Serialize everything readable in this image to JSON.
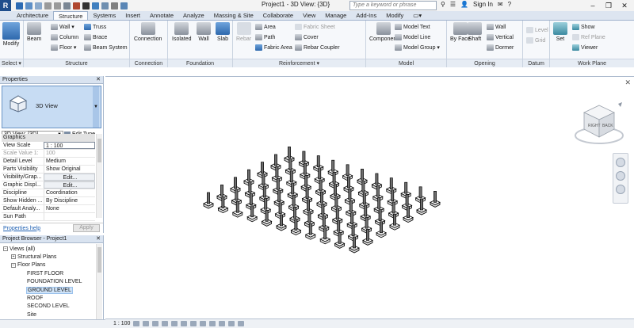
{
  "app": {
    "logo": "R",
    "doc_title": "Project1 - 3D View: {3D}",
    "search_placeholder": "Type a keyword or phrase",
    "sign_in": "Sign In"
  },
  "tabs": [
    "Architecture",
    "Structure",
    "Systems",
    "Insert",
    "Annotate",
    "Analyze",
    "Massing & Site",
    "Collaborate",
    "View",
    "Manage",
    "Add-Ins",
    "Modify"
  ],
  "active_tab": "Structure",
  "ribbon": {
    "select": {
      "modify": "Modify",
      "label": "Select ▾"
    },
    "structure": {
      "beam": "Beam",
      "wall": "Wall ▾",
      "column": "Column",
      "floor": "Floor ▾",
      "truss": "Truss",
      "brace": "Brace",
      "beam_system": "Beam System",
      "label": "Structure"
    },
    "connection": {
      "connection": "Connection",
      "label": "Connection"
    },
    "foundation": {
      "isolated": "Isolated",
      "wall": "Wall",
      "slab": "Slab",
      "label": "Foundation"
    },
    "reinforcement": {
      "rebar": "Rebar",
      "area": "Area",
      "path": "Path",
      "fabric_area": "Fabric Area",
      "fabric_sheet": "Fabric Sheet",
      "cover": "Cover",
      "rebar_coupler": "Rebar Coupler",
      "label": "Reinforcement ▾"
    },
    "model": {
      "component": "Component",
      "model_text": "Model Text",
      "model_line": "Model Line",
      "model_group": "Model Group ▾",
      "label": "Model"
    },
    "opening": {
      "by_face": "By Face",
      "shaft": "Shaft",
      "wall": "Wall",
      "vertical": "Vertical",
      "dormer": "Dormer",
      "label": "Opening"
    },
    "datum": {
      "level": "Level",
      "grid": "Grid",
      "label": "Datum"
    },
    "work_plane": {
      "set": "Set",
      "show": "Show",
      "ref_plane": "Ref Plane",
      "viewer": "Viewer",
      "label": "Work Plane"
    }
  },
  "properties": {
    "title": "Properties",
    "type_name": "3D View",
    "instance": "3D View: {3D}",
    "edit_type": "Edit Type",
    "group": "Graphics",
    "rows": [
      {
        "k": "View Scale",
        "v": "1 : 100",
        "style": "box"
      },
      {
        "k": "Scale Value 1:",
        "v": "100",
        "style": "muted"
      },
      {
        "k": "Detail Level",
        "v": "Medium",
        "style": ""
      },
      {
        "k": "Parts Visibility",
        "v": "Show Original",
        "style": ""
      },
      {
        "k": "Visibility/Grap...",
        "v": "Edit...",
        "style": "btn"
      },
      {
        "k": "Graphic Displ...",
        "v": "Edit...",
        "style": "btn"
      },
      {
        "k": "Discipline",
        "v": "Coordination",
        "style": ""
      },
      {
        "k": "Show Hidden ...",
        "v": "By Discipline",
        "style": ""
      },
      {
        "k": "Default Analy...",
        "v": "None",
        "style": ""
      },
      {
        "k": "Sun Path",
        "v": "",
        "style": ""
      }
    ],
    "help": "Properties help",
    "apply": "Apply"
  },
  "browser": {
    "title": "Project Browser - Project1",
    "nodes": [
      {
        "label": "Views (all)",
        "depth": 0,
        "toggle": "−"
      },
      {
        "label": "Structural Plans",
        "depth": 1,
        "toggle": "+"
      },
      {
        "label": "Floor Plans",
        "depth": 1,
        "toggle": "−"
      },
      {
        "label": "FIRST FLOOR",
        "depth": 2,
        "toggle": ""
      },
      {
        "label": "FOUNDATION LEVEL",
        "depth": 2,
        "toggle": ""
      },
      {
        "label": "GROUND LEVEL",
        "depth": 2,
        "toggle": "",
        "selected": true
      },
      {
        "label": "ROOF",
        "depth": 2,
        "toggle": ""
      },
      {
        "label": "SECOND LEVEL",
        "depth": 2,
        "toggle": ""
      },
      {
        "label": "Site",
        "depth": 2,
        "toggle": ""
      }
    ]
  },
  "viewcube": {
    "front": "RIGHT",
    "side": "BACK"
  },
  "viewbar": {
    "scale": "1 : 100"
  },
  "grid": {
    "rows": 7,
    "cols": 11
  }
}
